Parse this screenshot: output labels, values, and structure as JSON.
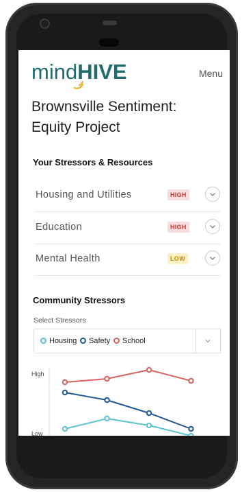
{
  "app": {
    "logo_part1": "mind",
    "logo_part2": "HIVE",
    "menu_label": "Menu",
    "title_line1": "Brownsville Sentiment:",
    "title_line2": "Equity Project"
  },
  "resources": {
    "heading": "Your Stressors & Resources",
    "items": [
      {
        "label": "Housing and Utilities",
        "level": "HIGH"
      },
      {
        "label": "Education",
        "level": "HIGH"
      },
      {
        "label": "Mental Health",
        "level": "LOW"
      }
    ]
  },
  "community": {
    "heading": "Community Stressors",
    "select_label": "Select Stressors",
    "selected": [
      {
        "name": "Housing",
        "color": "#5bc2d3"
      },
      {
        "name": "Safety",
        "color": "#1f5896"
      },
      {
        "name": "School",
        "color": "#d9625e"
      }
    ]
  },
  "colors": {
    "brand": "#1e6c6d",
    "accent": "#e6b63a"
  },
  "chart_data": {
    "type": "line",
    "ylabel_high": "High",
    "ylabel_low": "Low",
    "ylim": [
      0,
      10
    ],
    "x": [
      1,
      2,
      3,
      4
    ],
    "series": [
      {
        "name": "School",
        "color": "#d9625e",
        "values": [
          7.8,
          8.3,
          9.6,
          8.0
        ]
      },
      {
        "name": "Safety",
        "color": "#1f5896",
        "values": [
          6.3,
          5.2,
          3.3,
          1.0
        ]
      },
      {
        "name": "Housing",
        "color": "#5bc2d3",
        "values": [
          1.0,
          2.5,
          1.5,
          0.0
        ]
      }
    ]
  }
}
